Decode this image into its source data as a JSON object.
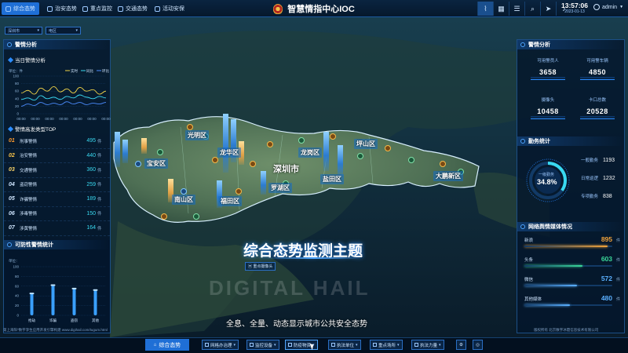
{
  "nav": {
    "tabs": [
      {
        "label": "综合态势",
        "active": true
      },
      {
        "label": "治安态势"
      },
      {
        "label": "重点监控"
      },
      {
        "label": "交通态势"
      },
      {
        "label": "活动安保"
      }
    ]
  },
  "header": {
    "title": "智慧情指中心IOC",
    "time": "13:57:06",
    "date": "2023-01-13",
    "user": "admin"
  },
  "toolbar_icons": [
    "chart-icon",
    "grid-icon",
    "list-icon",
    "search-icon",
    "send-icon",
    "bell-icon"
  ],
  "filters": {
    "city": "深圳市",
    "district": "电区"
  },
  "left": {
    "panel_title": "警情分析",
    "sub1": "当日警情分析",
    "chart_unit": "单位：件",
    "legend": [
      "实时",
      "同比",
      "环比"
    ],
    "sub2": "警情高发类型TOP",
    "ranking": [
      {
        "no": "01",
        "name": "刑事警情",
        "value": "495",
        "unit": "件",
        "color": "#ff9b2f"
      },
      {
        "no": "02",
        "name": "治安警情",
        "value": "440",
        "unit": "件",
        "color": "#ffc84a"
      },
      {
        "no": "03",
        "name": "交通警情",
        "value": "360",
        "unit": "件",
        "color": "#ffd86a"
      },
      {
        "no": "04",
        "name": "盗窃警情",
        "value": "259",
        "unit": "件",
        "color": "#cfe6ff"
      },
      {
        "no": "05",
        "name": "诈骗警情",
        "value": "189",
        "unit": "件",
        "color": "#cfe6ff"
      },
      {
        "no": "06",
        "name": "涉毒警情",
        "value": "150",
        "unit": "件",
        "color": "#cfe6ff"
      },
      {
        "no": "07",
        "name": "涉黄警情",
        "value": "164",
        "unit": "件",
        "color": "#cfe6ff"
      }
    ],
    "panel2_title": "可防性警情统计",
    "bar_unit": "单位："
  },
  "chart_data": [
    {
      "type": "line",
      "title": "当日警情分析",
      "x": [
        "00:00",
        "00:00",
        "00:00",
        "00:00",
        "00:00",
        "00:00",
        "00:00"
      ],
      "ylim": [
        0,
        100
      ],
      "yticks": [
        "100",
        "80",
        "60",
        "40",
        "20",
        "0"
      ],
      "series": [
        {
          "name": "实时",
          "color": "#f2d548",
          "values": [
            55,
            62,
            52,
            68,
            60,
            72,
            58,
            66,
            55,
            70,
            60,
            64,
            52,
            60
          ]
        },
        {
          "name": "同比",
          "color": "#3ad8f0",
          "values": [
            38,
            42,
            36,
            48,
            40,
            44,
            38,
            46,
            42,
            50,
            44,
            40,
            46,
            42
          ]
        },
        {
          "name": "环比",
          "color": "#4b8cff",
          "values": [
            20,
            26,
            22,
            30,
            24,
            28,
            24,
            32,
            26,
            30,
            24,
            28,
            26,
            30
          ]
        }
      ]
    },
    {
      "type": "bar",
      "title": "可防性警情统计",
      "categories": [
        "抢劫",
        "诈骗",
        "盗窃",
        "其他"
      ],
      "ylim": [
        0,
        100
      ],
      "yticks": [
        "100",
        "80",
        "60",
        "40",
        "20",
        "0"
      ],
      "values": [
        45,
        62,
        55,
        52
      ]
    }
  ],
  "map": {
    "city": "深圳市",
    "districts": [
      "光明区",
      "龙华区",
      "宝安区",
      "龙岗区",
      "坪山区",
      "南山区",
      "福田区",
      "罗湖区",
      "盐田区",
      "大鹏新区"
    ],
    "watermark": "DIGITAL HAIL",
    "subject": "综合态势监测主题",
    "caption": "全息、全量、动态显示城市公共安全态势",
    "cam_label": "重点摄像头"
  },
  "right": {
    "panel_title": "警情分析",
    "kpis": [
      {
        "label": "可用警员人",
        "value": "3658"
      },
      {
        "label": "可用警车辆",
        "value": "4850"
      },
      {
        "label": "摄像头",
        "value": "10458"
      },
      {
        "label": "卡口总数",
        "value": "20528"
      }
    ],
    "duty_title": "勤务统计",
    "ring_label": "一级勤务",
    "ring_value": "34.8%",
    "ring_pct": 0.348,
    "duty": [
      {
        "label": "一般勤务",
        "value": "1193"
      },
      {
        "label": "日常巡逻",
        "value": "1232"
      },
      {
        "label": "专项勤务",
        "value": "838"
      }
    ],
    "media_title": "网络舆情媒体情况",
    "media": [
      {
        "name": "新浪",
        "value": "895",
        "unit": "件",
        "color": "#f0a23a",
        "pct": 0.95
      },
      {
        "name": "头条",
        "value": "603",
        "unit": "件",
        "color": "#3ad89a",
        "pct": 0.66
      },
      {
        "name": "微信",
        "value": "572",
        "unit": "件",
        "color": "#5ab0ff",
        "pct": 0.6
      },
      {
        "name": "其他媒体",
        "value": "480",
        "unit": "件",
        "color": "#5ab0ff",
        "pct": 0.52
      }
    ]
  },
  "footer": {
    "copyright_left": "第上海阳\"数字孪生应用开发引擎构建 www.digihail.com/tugum.html",
    "copyright_right": "版权所有 北京数字冰雹信息技术有限公司",
    "main_button": "综合态势",
    "buttons": [
      "网格办治理",
      "监控设备",
      "防疫物资",
      "执法单位",
      "重点场所",
      "执法力量"
    ]
  },
  "colors": {
    "accent": "#1f6fd6",
    "cyan": "#39d9f0",
    "orange": "#ff9b2f"
  }
}
